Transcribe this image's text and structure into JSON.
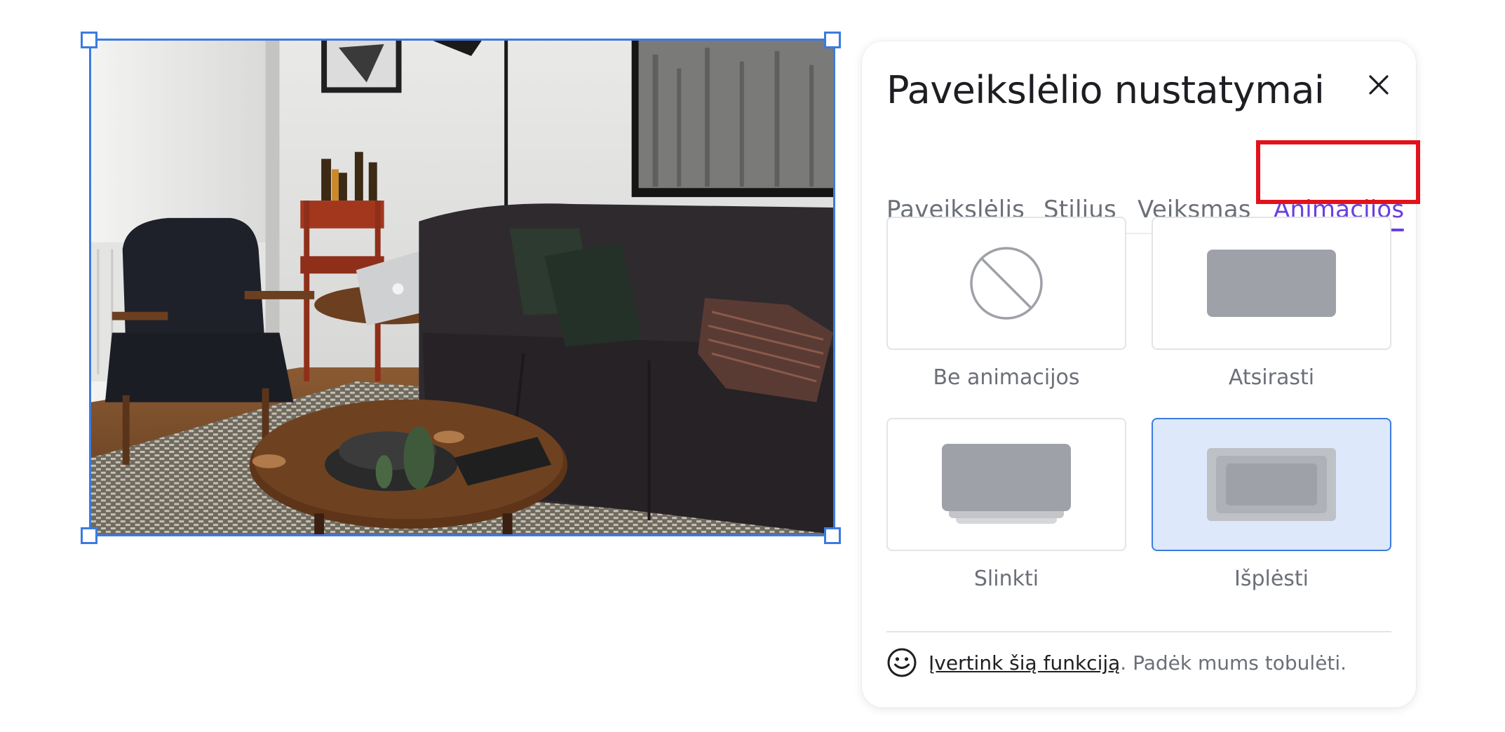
{
  "panel": {
    "title": "Paveikslėlio nustatymai",
    "close_icon": "close-icon"
  },
  "tabs": [
    {
      "label": "Paveikslėlis",
      "active": false
    },
    {
      "label": "Stilius",
      "active": false
    },
    {
      "label": "Veiksmas",
      "active": false
    },
    {
      "label": "Animacijos",
      "active": true
    }
  ],
  "animations": [
    {
      "label": "Be animacijos",
      "icon": "no-animation-icon",
      "selected": false
    },
    {
      "label": "Atsirasti",
      "icon": "fade-in-icon",
      "selected": false
    },
    {
      "label": "Slinkti",
      "icon": "slide-icon",
      "selected": false
    },
    {
      "label": "Išplėsti",
      "icon": "expand-icon",
      "selected": true
    }
  ],
  "footer": {
    "icon": "smiley-icon",
    "link_text": "Įvertink šią funkciją",
    "text": ". Padėk mums tobulėti."
  },
  "colors": {
    "accent": "#6a3fe0",
    "selection": "#3b7be0",
    "highlight_box": "#e2121b",
    "selected_card_bg": "#dde8fb"
  },
  "canvas": {
    "image_subject": "living room with sofa, armchair and round coffee table",
    "image_selected": true
  }
}
